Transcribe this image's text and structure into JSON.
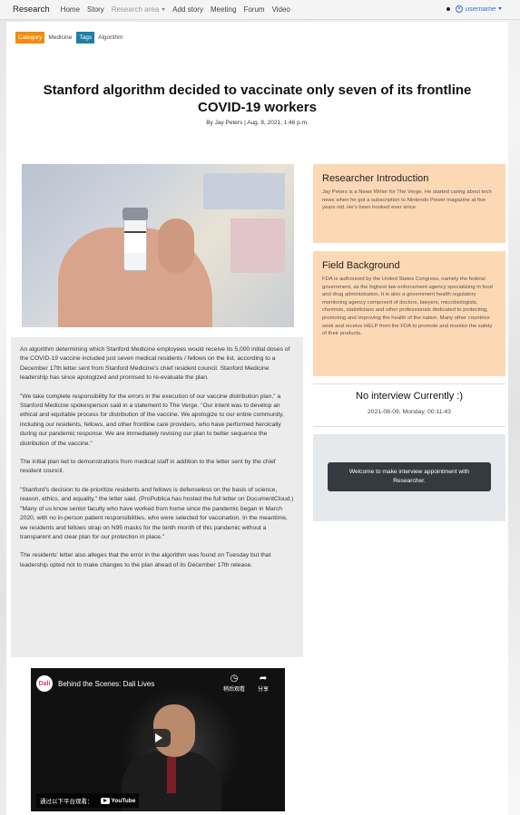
{
  "navbar": {
    "brand": "Research",
    "links": [
      "Home",
      "Story",
      "Research area",
      "Add story",
      "Meeting",
      "Forum",
      "Video"
    ],
    "username": "username"
  },
  "tags": {
    "category_label": "Category",
    "category_value": "Medicine",
    "tags_label": "Tags",
    "tags_value": "Algorithm"
  },
  "article": {
    "title": "Stanford algorithm decided to vaccinate only seven of its frontline COVID-19 workers",
    "byline": "By Jay Peters  | Aug. 8, 2021, 1:46 p.m.",
    "paragraphs": [
      "An algorithm determining which Stanford Medicine employees would receive its 5,000 initial doses of the COVID-19 vaccine included just seven medical residents / fellows on the list, according to a December 17th letter sent from Stanford Medicine's chief resident council. Stanford Medicine leadership has since apologized and promised to re-evaluate the plan.",
      "\"We take complete responsibility for the errors in the execution of our vaccine distribution plan,\" a Stanford Medicine spokesperson said in a statement to The Verge. \"Our intent was to develop an ethical and equitable process for distribution of the vaccine. We apologize to our entire community, including our residents, fellows, and other frontline care providers, who have performed heroically during our pandemic response. We are immediately revising our plan to better sequence the distribution of the vaccine.\"",
      "The initial plan led to demonstrations from medical staff in addition to the letter sent by the chief resident council.",
      "\"Stanford's decision to de-prioritize residents and fellows is defenseless on the basis of science, reason, ethics, and equality,\" the letter said. (ProPublica has hosted the full letter on DocumentCloud.) \"Many of us know senior faculty who have worked from home since the pandemic began in March 2020, with no in-person patient responsibilities, who were selected for vaccination. In the meantime, we residents and fellows strap on N95 masks for the tenth month of this pandemic without a transparent and clear plan for our protection in place.\"",
      "The residents' letter also alleges that the error in the algorithm was found on Tuesday but that leadership opted not to make changes to the plan ahead of its December 17th release."
    ]
  },
  "video": {
    "title": "Behind the Scenes: Dali Lives",
    "channel_badge": "Dali",
    "watch_later": "稍后观看",
    "share": "分享",
    "footer_text": "通过以下平台观看：",
    "youtube": "YouTube"
  },
  "sidebar": {
    "researcher_heading": "Researcher Introduction",
    "researcher_text": "Jay Peters is a News Writer for The Verge. He started caring about tech news when he got a subscription to Nintendo Power magazine at five years old. He's been hooked ever since.",
    "field_heading": "Field Background",
    "field_text": "FDA is authorized by the United States Congress, namely the federal government, as the highest law enforcement agency specializing in food and drug administration. It is also a government health regulatory monitoring agency composed of doctors, lawyers, microbiologists, chemists, statisticians and other professionals dedicated to protecting, promoting and improving the health of the nation. Many other countries seek and receive HELP from the FDA to promote and monitor the safety of their products.",
    "no_interview": "No interview Currently :)",
    "datetime": "2021-08-09, Monday, 00:11:43",
    "appointment_button": "Welcome to make interview appointment with Researcher."
  },
  "colors": {
    "category_badge": "#f28c0f",
    "tags_badge": "#1d7fa8",
    "sidebar_box": "#fdd8b5",
    "username_link": "#2b6fd6"
  }
}
